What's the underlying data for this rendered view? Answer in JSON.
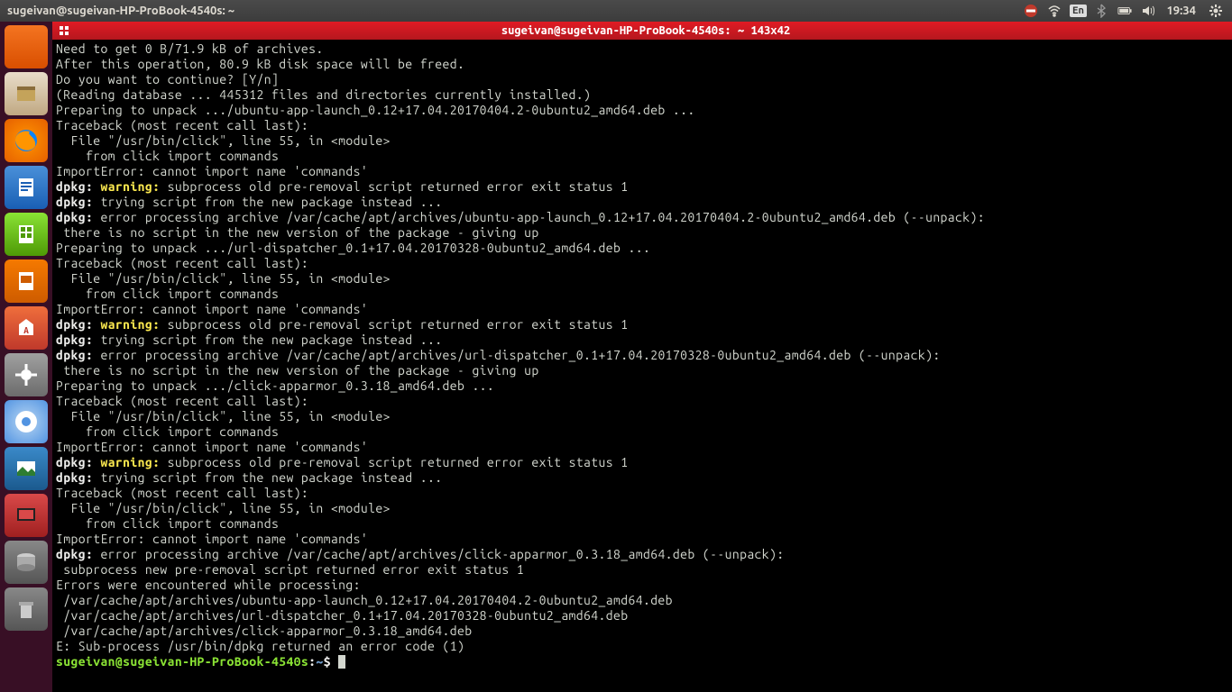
{
  "panel": {
    "title": "sugeivan@sugeivan-HP-ProBook-4540s: ~",
    "lang": "En",
    "time": "19:34"
  },
  "launcher": {
    "items": [
      {
        "name": "dash",
        "class": "ubuntu"
      },
      {
        "name": "files",
        "class": "files"
      },
      {
        "name": "firefox",
        "class": "firefox"
      },
      {
        "name": "writer",
        "class": "writer"
      },
      {
        "name": "calc",
        "class": "calc"
      },
      {
        "name": "impress",
        "class": "impress"
      },
      {
        "name": "software",
        "class": "software"
      },
      {
        "name": "settings",
        "class": "settings"
      },
      {
        "name": "chromium",
        "class": "chromium"
      },
      {
        "name": "wallpaper",
        "class": "wallpaper"
      },
      {
        "name": "screenshot",
        "class": "screenshot"
      },
      {
        "name": "disks",
        "class": "disks"
      },
      {
        "name": "trash",
        "class": "trash"
      }
    ]
  },
  "terminal": {
    "title": "sugeivan@sugeivan-HP-ProBook-4540s: ~ 143x42",
    "prompt": {
      "user_host": "sugeivan@sugeivan-HP-ProBook-4540s",
      "sep1": ":",
      "path": "~",
      "sep2": "$ "
    },
    "lines": [
      [
        {
          "t": "Need to get 0 B/71.9 kB of archives."
        }
      ],
      [
        {
          "t": "After this operation, 80.9 kB disk space will be freed."
        }
      ],
      [
        {
          "t": "Do you want to continue? [Y/n]"
        }
      ],
      [
        {
          "t": "(Reading database ... 445312 files and directories currently installed.)"
        }
      ],
      [
        {
          "t": "Preparing to unpack .../ubuntu-app-launch_0.12+17.04.20170404.2-0ubuntu2_amd64.deb ..."
        }
      ],
      [
        {
          "t": "Traceback (most recent call last):"
        }
      ],
      [
        {
          "t": "  File \"/usr/bin/click\", line 55, in <module>"
        }
      ],
      [
        {
          "t": "    from click import commands"
        }
      ],
      [
        {
          "t": "ImportError: cannot import name 'commands'"
        }
      ],
      [
        {
          "c": "bold-white",
          "t": "dpkg: "
        },
        {
          "c": "bold-yellow",
          "t": "warning:"
        },
        {
          "t": " subprocess old pre-removal script returned error exit status 1"
        }
      ],
      [
        {
          "c": "bold-white",
          "t": "dpkg:"
        },
        {
          "t": " trying script from the new package instead ..."
        }
      ],
      [
        {
          "c": "bold-white",
          "t": "dpkg:"
        },
        {
          "t": " error processing archive /var/cache/apt/archives/ubuntu-app-launch_0.12+17.04.20170404.2-0ubuntu2_amd64.deb (--unpack):"
        }
      ],
      [
        {
          "t": " there is no script in the new version of the package - giving up"
        }
      ],
      [
        {
          "t": "Preparing to unpack .../url-dispatcher_0.1+17.04.20170328-0ubuntu2_amd64.deb ..."
        }
      ],
      [
        {
          "t": "Traceback (most recent call last):"
        }
      ],
      [
        {
          "t": "  File \"/usr/bin/click\", line 55, in <module>"
        }
      ],
      [
        {
          "t": "    from click import commands"
        }
      ],
      [
        {
          "t": "ImportError: cannot import name 'commands'"
        }
      ],
      [
        {
          "c": "bold-white",
          "t": "dpkg: "
        },
        {
          "c": "bold-yellow",
          "t": "warning:"
        },
        {
          "t": " subprocess old pre-removal script returned error exit status 1"
        }
      ],
      [
        {
          "c": "bold-white",
          "t": "dpkg:"
        },
        {
          "t": " trying script from the new package instead ..."
        }
      ],
      [
        {
          "c": "bold-white",
          "t": "dpkg:"
        },
        {
          "t": " error processing archive /var/cache/apt/archives/url-dispatcher_0.1+17.04.20170328-0ubuntu2_amd64.deb (--unpack):"
        }
      ],
      [
        {
          "t": " there is no script in the new version of the package - giving up"
        }
      ],
      [
        {
          "t": "Preparing to unpack .../click-apparmor_0.3.18_amd64.deb ..."
        }
      ],
      [
        {
          "t": "Traceback (most recent call last):"
        }
      ],
      [
        {
          "t": "  File \"/usr/bin/click\", line 55, in <module>"
        }
      ],
      [
        {
          "t": "    from click import commands"
        }
      ],
      [
        {
          "t": "ImportError: cannot import name 'commands'"
        }
      ],
      [
        {
          "c": "bold-white",
          "t": "dpkg: "
        },
        {
          "c": "bold-yellow",
          "t": "warning:"
        },
        {
          "t": " subprocess old pre-removal script returned error exit status 1"
        }
      ],
      [
        {
          "c": "bold-white",
          "t": "dpkg:"
        },
        {
          "t": " trying script from the new package instead ..."
        }
      ],
      [
        {
          "t": "Traceback (most recent call last):"
        }
      ],
      [
        {
          "t": "  File \"/usr/bin/click\", line 55, in <module>"
        }
      ],
      [
        {
          "t": "    from click import commands"
        }
      ],
      [
        {
          "t": "ImportError: cannot import name 'commands'"
        }
      ],
      [
        {
          "c": "bold-white",
          "t": "dpkg:"
        },
        {
          "t": " error processing archive /var/cache/apt/archives/click-apparmor_0.3.18_amd64.deb (--unpack):"
        }
      ],
      [
        {
          "t": " subprocess new pre-removal script returned error exit status 1"
        }
      ],
      [
        {
          "t": "Errors were encountered while processing:"
        }
      ],
      [
        {
          "t": " /var/cache/apt/archives/ubuntu-app-launch_0.12+17.04.20170404.2-0ubuntu2_amd64.deb"
        }
      ],
      [
        {
          "t": " /var/cache/apt/archives/url-dispatcher_0.1+17.04.20170328-0ubuntu2_amd64.deb"
        }
      ],
      [
        {
          "t": " /var/cache/apt/archives/click-apparmor_0.3.18_amd64.deb"
        }
      ],
      [
        {
          "t": "E: Sub-process /usr/bin/dpkg returned an error code (1)"
        }
      ]
    ]
  }
}
